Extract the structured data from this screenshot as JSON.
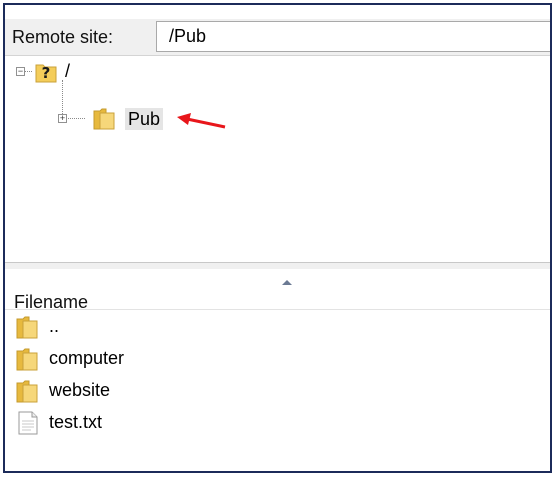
{
  "site_bar": {
    "label": "Remote site:",
    "path_value": "/Pub"
  },
  "tree": {
    "root": {
      "label": "/",
      "icon": "unknown-folder-icon",
      "expanded": true
    },
    "children": [
      {
        "label": "Pub",
        "icon": "folder-icon",
        "expanded": false,
        "highlighted": true
      }
    ],
    "annotation": "red-arrow-pointing-at-pub"
  },
  "file_list": {
    "column_header": "Filename",
    "sort_indicator": "ascending",
    "items": [
      {
        "name": "..",
        "icon": "folder-icon"
      },
      {
        "name": "computer",
        "icon": "folder-icon"
      },
      {
        "name": "website",
        "icon": "folder-icon"
      },
      {
        "name": "test.txt",
        "icon": "text-file-icon"
      }
    ]
  },
  "colors": {
    "frame_border": "#1c2b5a",
    "annotation_arrow": "#e8161b",
    "folder_yellow": "#f4cd5a",
    "highlight_bg": "#e5e5e5"
  }
}
